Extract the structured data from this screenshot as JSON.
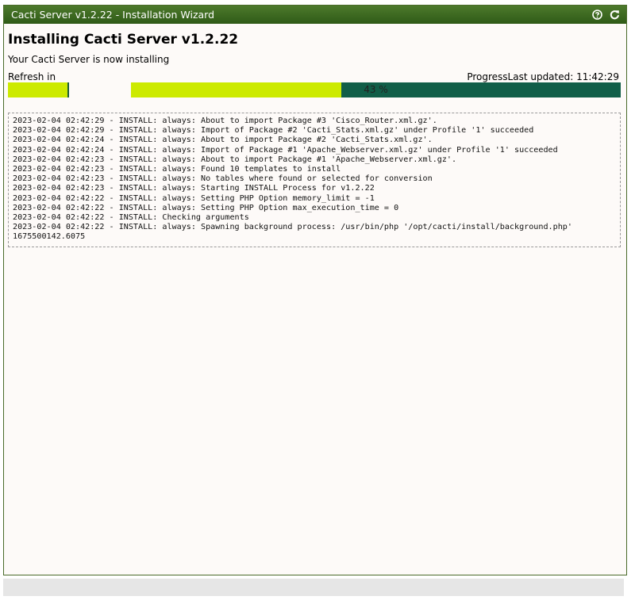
{
  "window": {
    "title": "Cacti Server v1.2.22 - Installation Wizard",
    "help_icon": "help-icon",
    "refresh_icon": "refresh-icon"
  },
  "main": {
    "heading": "Installing Cacti Server v1.2.22",
    "subtitle": "Your Cacti Server is now installing",
    "refresh_label": "Refresh in",
    "progress_label": "Progress",
    "last_updated": "Last updated: 11:42:29",
    "progress_text": "43 %",
    "progress_percent": 43,
    "log_lines": [
      "2023-02-04 02:42:29 - INSTALL: always: About to import Package #3 'Cisco_Router.xml.gz'.",
      "2023-02-04 02:42:29 - INSTALL: always: Import of Package #2 'Cacti_Stats.xml.gz' under Profile '1' succeeded",
      "2023-02-04 02:42:24 - INSTALL: always: About to import Package #2 'Cacti_Stats.xml.gz'.",
      "2023-02-04 02:42:24 - INSTALL: always: Import of Package #1 'Apache_Webserver.xml.gz' under Profile '1' succeeded",
      "2023-02-04 02:42:23 - INSTALL: always: About to import Package #1 'Apache_Webserver.xml.gz'.",
      "2023-02-04 02:42:23 - INSTALL: always: Found 10 templates to install",
      "2023-02-04 02:42:23 - INSTALL: always: No tables where found or selected for conversion",
      "2023-02-04 02:42:23 - INSTALL: always: Starting INSTALL Process for v1.2.22",
      "2023-02-04 02:42:22 - INSTALL: always: Setting PHP Option memory_limit = -1",
      "2023-02-04 02:42:22 - INSTALL: always: Setting PHP Option max_execution_time = 0",
      "2023-02-04 02:42:22 - INSTALL: Checking arguments",
      "2023-02-04 02:42:22 - INSTALL: always: Spawning background process: /usr/bin/php '/opt/cacti/install/background.php'",
      "1675500142.6075"
    ]
  },
  "colors": {
    "accent": "#ccea00",
    "progress_track": "#115e48",
    "titlebar": "#3b6a20"
  }
}
